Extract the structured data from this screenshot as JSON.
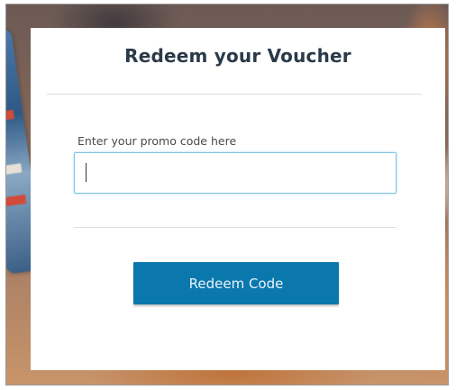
{
  "modal": {
    "title": "Redeem your Voucher",
    "promo_label": "Enter your promo code here",
    "promo_value": "",
    "button_label": "Redeem Code"
  },
  "colors": {
    "title_text": "#2b3a49",
    "input_focus_border": "#7ec7e6",
    "button_background": "#0b78ad",
    "button_text": "#e8f4fb"
  }
}
